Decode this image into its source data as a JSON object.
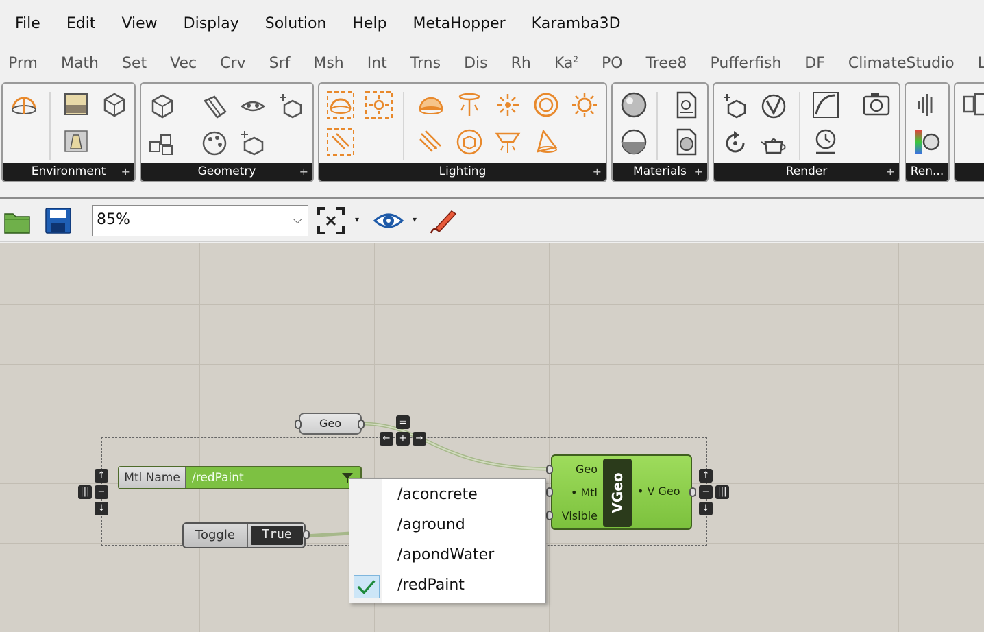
{
  "menu": [
    "File",
    "Edit",
    "View",
    "Display",
    "Solution",
    "Help",
    "MetaHopper",
    "Karamba3D"
  ],
  "tabs": [
    {
      "label": "Prm"
    },
    {
      "label": "Math"
    },
    {
      "label": "Set"
    },
    {
      "label": "Vec"
    },
    {
      "label": "Crv"
    },
    {
      "label": "Srf"
    },
    {
      "label": "Msh"
    },
    {
      "label": "Int"
    },
    {
      "label": "Trns"
    },
    {
      "label": "Dis"
    },
    {
      "label": "Rh"
    },
    {
      "label": "Ka",
      "sup": "2"
    },
    {
      "label": "PO"
    },
    {
      "label": "Tree8"
    },
    {
      "label": "Pufferfish"
    },
    {
      "label": "DF"
    },
    {
      "label": "ClimateStudio"
    },
    {
      "label": "LB"
    }
  ],
  "ribbon": {
    "panels": [
      "Environment",
      "Geometry",
      "Lighting",
      "Materials",
      "Render",
      "Ren..."
    ],
    "plus": "+"
  },
  "toolbar": {
    "zoom_value": "85%",
    "caret": "⌵",
    "drop_arrow": "▾"
  },
  "canvas": {
    "geo_param": "Geo",
    "mtl_component": {
      "label": "Mtl Name",
      "value": "/redPaint"
    },
    "toggle": {
      "label": "Toggle",
      "value": "True"
    },
    "vgeo": {
      "title": "VGeo",
      "inputs": [
        "Geo",
        "• Mtl",
        "Visible"
      ],
      "output": "• V Geo"
    }
  },
  "dropdown": {
    "options": [
      "/aconcrete",
      "/aground",
      "/apondWater",
      "/redPaint"
    ],
    "selected": "/redPaint"
  },
  "colors": {
    "component_green": "#7dc142",
    "canvas_bg": "#d4d0c8",
    "ribbon_footer": "#1c1c1c",
    "accent_orange": "#e8892c"
  }
}
